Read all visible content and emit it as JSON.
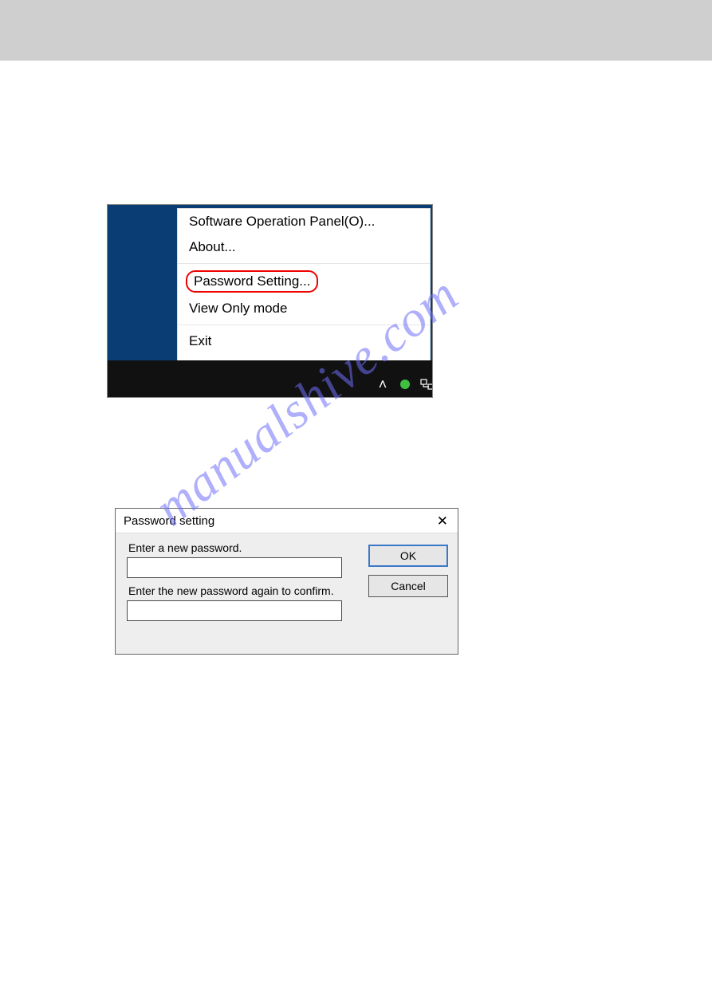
{
  "watermark": "manualshive.com",
  "context_menu": {
    "items": [
      "Software Operation Panel(O)...",
      "About..."
    ],
    "highlighted": "Password Setting...",
    "items2": [
      "View Only mode"
    ],
    "exit": "Exit"
  },
  "dialog": {
    "title": "Password setting",
    "label1": "Enter a new password.",
    "label2": "Enter the new password again to confirm.",
    "ok": "OK",
    "cancel": "Cancel"
  }
}
